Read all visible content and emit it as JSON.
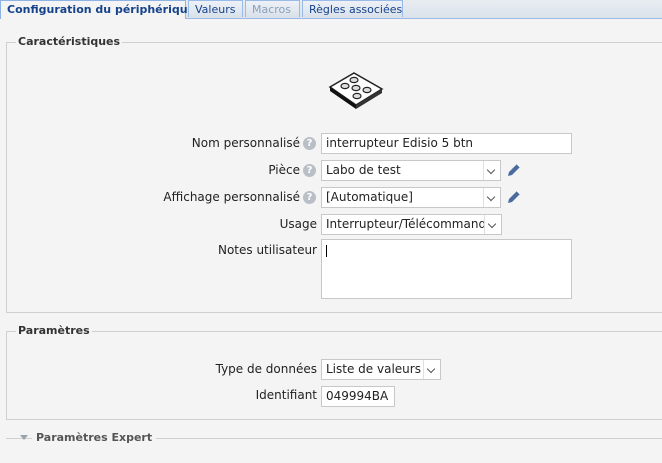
{
  "tabs": [
    {
      "label": "Configuration du périphérique",
      "state": "active"
    },
    {
      "label": "Valeurs",
      "state": "normal"
    },
    {
      "label": "Macros",
      "state": "disabled"
    },
    {
      "label": "Règles associées",
      "state": "normal"
    }
  ],
  "caracteristiques": {
    "legend": "Caractéristiques",
    "device_icon": "remote-5-button-icon",
    "nom": {
      "label": "Nom personnalisé",
      "value": "interrupteur Edisio 5 btn"
    },
    "piece": {
      "label": "Pièce",
      "value": "Labo de test"
    },
    "affichage": {
      "label": "Affichage personnalisé",
      "value": "[Automatique]"
    },
    "usage": {
      "label": "Usage",
      "value": "Interrupteur/Télécommande"
    },
    "notes": {
      "label": "Notes utilisateur",
      "value": ""
    }
  },
  "parametres": {
    "legend": "Paramètres",
    "type_donnees": {
      "label": "Type de données",
      "value": "Liste de valeurs"
    },
    "identifiant": {
      "label": "Identifiant",
      "value": "049994BA"
    }
  },
  "expert": {
    "legend": "Paramètres Expert"
  },
  "colors": {
    "tab_text": "#15428b",
    "tab_border": "#99bbe8",
    "background": "#f4f4f4",
    "pencil": "#4b6aa0"
  }
}
